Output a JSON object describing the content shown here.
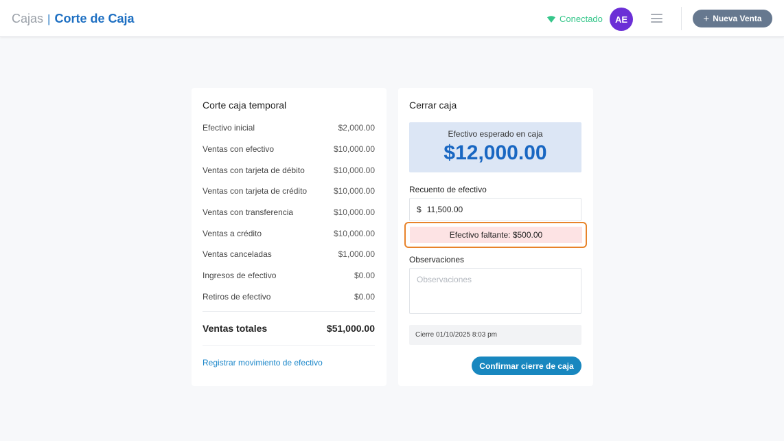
{
  "header": {
    "breadcrumb_parent": "Cajas",
    "breadcrumb_separator": "|",
    "breadcrumb_current": "Corte de Caja",
    "status_text": "Conectado",
    "avatar_initials": "AE",
    "new_sale_label": "Nueva Venta"
  },
  "summary": {
    "title": "Corte caja temporal",
    "rows": [
      {
        "label": "Efectivo inicial",
        "value": "$2,000.00"
      },
      {
        "label": "Ventas con efectivo",
        "value": "$10,000.00"
      },
      {
        "label": "Ventas con tarjeta de débito",
        "value": "$10,000.00"
      },
      {
        "label": "Ventas con tarjeta de crédito",
        "value": "$10,000.00"
      },
      {
        "label": "Ventas con transferencia",
        "value": "$10,000.00"
      },
      {
        "label": "Ventas a crédito",
        "value": "$10,000.00"
      },
      {
        "label": "Ventas canceladas",
        "value": "$1,000.00"
      },
      {
        "label": "Ingresos de efectivo",
        "value": "$0.00"
      },
      {
        "label": "Retiros de efectivo",
        "value": "$0.00"
      }
    ],
    "total_label": "Ventas totales",
    "total_value": "$51,000.00",
    "register_link": "Registrar movimiento de efectivo"
  },
  "close": {
    "title": "Cerrar caja",
    "expected_label": "Efectivo esperado en caja",
    "expected_amount": "$12,000.00",
    "count_label": "Recuento de efectivo",
    "currency_symbol": "$",
    "count_value": "11,500.00",
    "missing_text": "Efectivo faltante: $500.00",
    "observations_label": "Observaciones",
    "observations_placeholder": "Observaciones",
    "closing_info": "Cierre 01/10/2025 8:03 pm",
    "confirm_label": "Confirmar cierre de caja"
  },
  "colors": {
    "brand_blue": "#1d6fc2",
    "status_green": "#35c68a",
    "avatar_purple": "#6b2fd6",
    "warning_orange": "#e8832a",
    "missing_bg": "#fde3e4",
    "confirm_blue": "#1887bf"
  },
  "icons": {
    "status": "wifi-icon",
    "menu": "hamburger-menu-icon",
    "new_sale": "plus-icon"
  }
}
